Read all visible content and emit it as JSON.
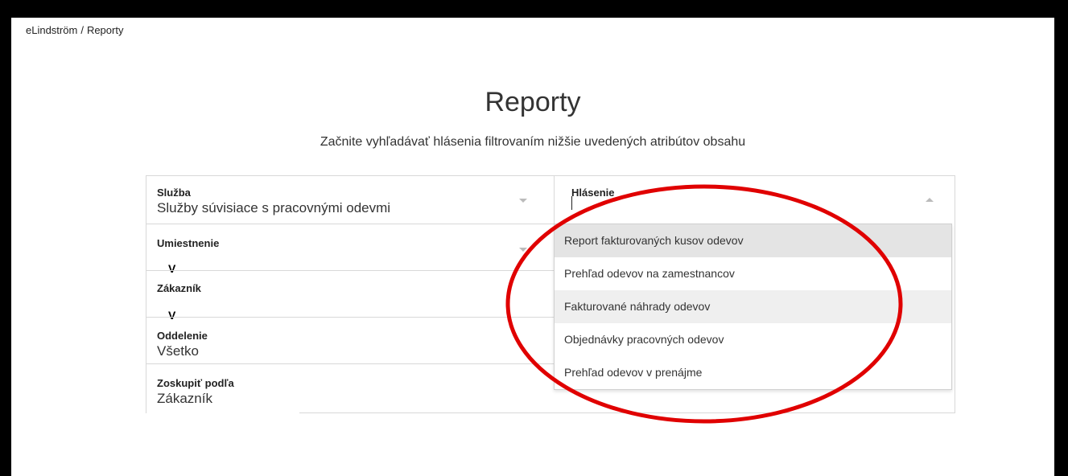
{
  "breadcrumb": {
    "root": "eLindström",
    "separator": "/",
    "current": "Reporty"
  },
  "page": {
    "title": "Reporty",
    "subtitle": "Začnite vyhľadávať hlásenia filtrovaním nižšie uvedených atribútov obsahu"
  },
  "filters": {
    "sluzba": {
      "label": "Služba",
      "value": "Služby súvisiace s pracovnými odevmi"
    },
    "umiestnenie": {
      "label": "Umiestnenie",
      "value": "",
      "marker": "V"
    },
    "zakaznik": {
      "label": "Zákazník",
      "value": "",
      "marker": "V"
    },
    "oddelenie": {
      "label": "Oddelenie",
      "value": "Všetko"
    },
    "zoskupit": {
      "label": "Zoskupiť podľa",
      "value": "Zákazník"
    },
    "hlasenie": {
      "label": "Hlásenie",
      "value": ""
    }
  },
  "dropdown": {
    "options": [
      "Report fakturovaných kusov odevov",
      "Prehľad odevov na zamestnancov",
      "Fakturované náhrady odevov",
      "Objednávky pracovných odevov",
      "Prehľad odevov v prenájme"
    ],
    "highlighted_index": 0
  },
  "colors": {
    "annotation_red": "#e00000",
    "frame_black": "#000000"
  },
  "icons": {
    "select_arrow": "chevron-down-icon",
    "select_arrow_open": "chevron-up-icon"
  }
}
